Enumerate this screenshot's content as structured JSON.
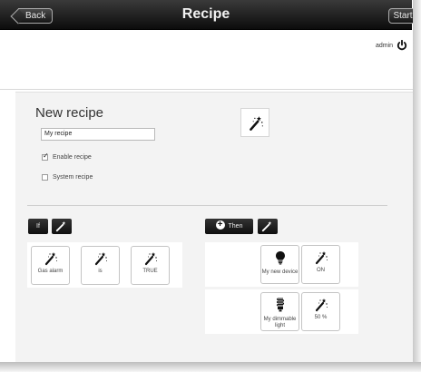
{
  "titlebar": {
    "back_label": "Back",
    "title": "Recipe",
    "start_label": "Start"
  },
  "user": {
    "name": "admin",
    "logout_icon": "power-icon"
  },
  "recipe": {
    "heading": "New recipe",
    "name_value": "My recipe",
    "enable_label": "Enable recipe",
    "enable_checked": true,
    "system_label": "System recipe",
    "system_checked": false,
    "wand_icon": "magic-wand-icon"
  },
  "if_section": {
    "if_label": "If",
    "conditions": [
      {
        "label": "Gas alarm",
        "icon": "magic-wand-icon"
      },
      {
        "label": "is",
        "icon": "magic-wand-icon"
      },
      {
        "label": "TRUE",
        "icon": "magic-wand-icon"
      }
    ]
  },
  "then_section": {
    "then_label": "Then",
    "actions": [
      {
        "device": "My new device",
        "device_icon": "light-bulb-icon",
        "value": "ON",
        "value_icon": "magic-wand-icon"
      },
      {
        "device": "My dimmable light",
        "device_icon": "cfl-bulb-icon",
        "value": "50 %",
        "value_icon": "magic-wand-icon"
      }
    ]
  }
}
